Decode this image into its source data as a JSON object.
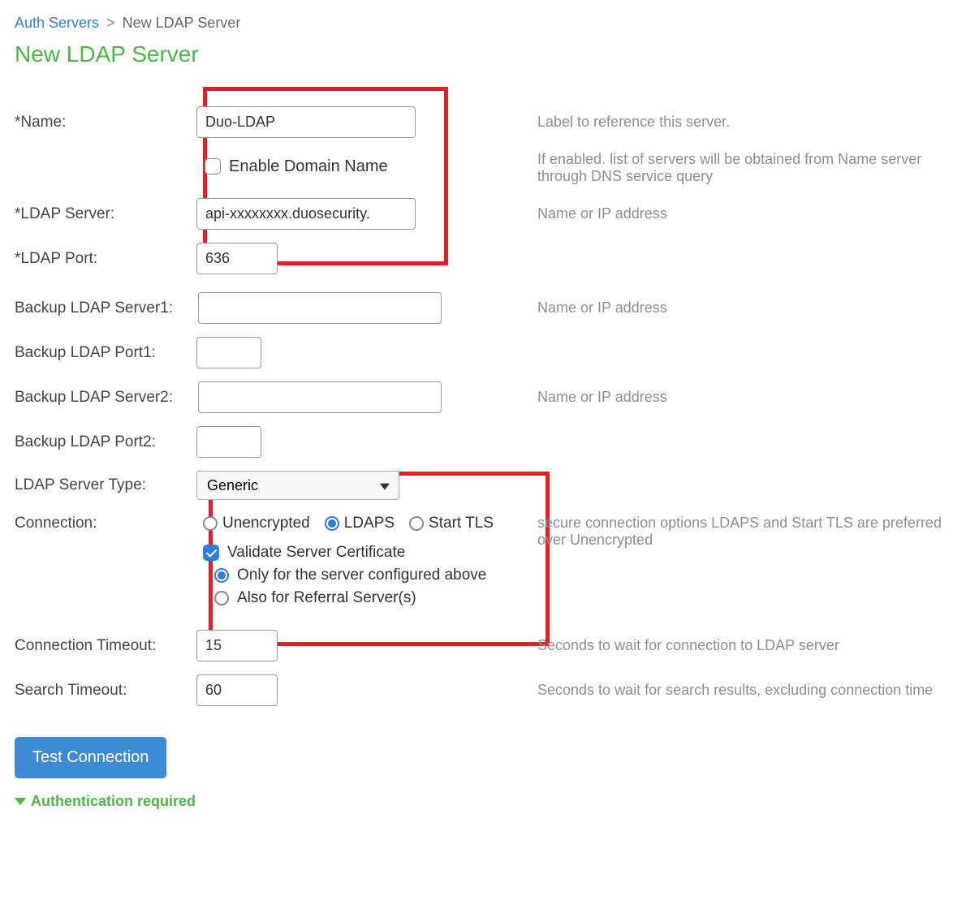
{
  "breadcrumb": {
    "parent": "Auth Servers",
    "sep": ">",
    "current": "New LDAP Server"
  },
  "page_title": "New LDAP Server",
  "fields": {
    "name": {
      "label": "*Name:",
      "value": "Duo-LDAP",
      "help": "Label to reference this server."
    },
    "enable_domain": {
      "label": "Enable Domain Name",
      "checked": false,
      "help": "If enabled. list of servers will be obtained from Name server through DNS service query"
    },
    "ldap_server": {
      "label": "*LDAP Server:",
      "value": "api-xxxxxxxx.duosecurity.",
      "help": "Name or IP address"
    },
    "ldap_port": {
      "label": "*LDAP Port:",
      "value": "636"
    },
    "backup_server1": {
      "label": "Backup LDAP Server1:",
      "value": "",
      "help": "Name or IP address"
    },
    "backup_port1": {
      "label": "Backup LDAP Port1:",
      "value": ""
    },
    "backup_server2": {
      "label": "Backup LDAP Server2:",
      "value": "",
      "help": "Name or IP address"
    },
    "backup_port2": {
      "label": "Backup LDAP Port2:",
      "value": ""
    },
    "server_type": {
      "label": "LDAP Server Type:",
      "selected": "Generic",
      "options": [
        "Generic"
      ]
    },
    "connection": {
      "label": "Connection:",
      "options": {
        "unencrypted": "Unencrypted",
        "ldaps": "LDAPS",
        "starttls": "Start TLS"
      },
      "selected": "ldaps",
      "help": "secure connection options LDAPS and Start TLS are preferred over Unencrypted",
      "validate_cert": {
        "label": "Validate Server Certificate",
        "checked": true
      },
      "scope": {
        "only": "Only for the server configured above",
        "also": "Also for Referral Server(s)",
        "selected": "only"
      }
    },
    "conn_timeout": {
      "label": "Connection Timeout:",
      "value": "15",
      "help": "Seconds to wait for connection to LDAP server"
    },
    "search_timeout": {
      "label": "Search Timeout:",
      "value": "60",
      "help": "Seconds to wait for search results, excluding connection time"
    }
  },
  "buttons": {
    "test_connection": "Test Connection"
  },
  "sections": {
    "auth_required": "Authentication required"
  }
}
